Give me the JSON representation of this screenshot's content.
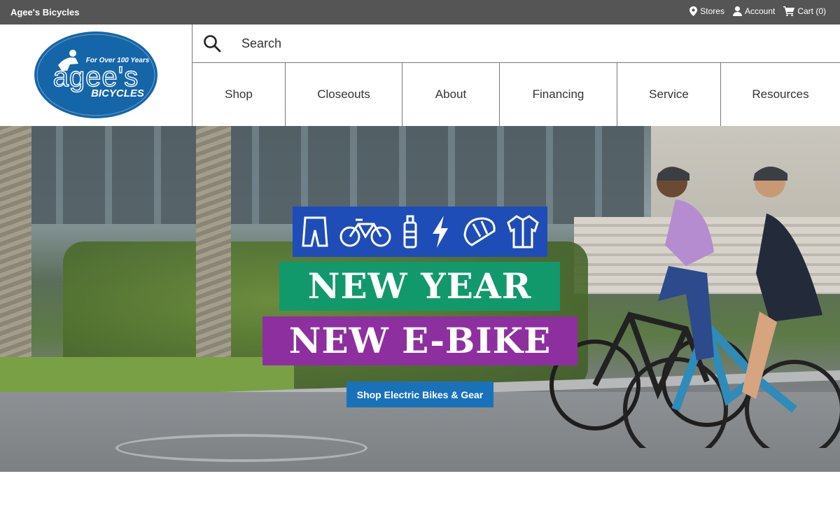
{
  "topbar": {
    "site_name": "Agee's Bicycles",
    "links": [
      {
        "label": "Stores",
        "icon": "map-pin-icon"
      },
      {
        "label": "Account",
        "icon": "user-icon"
      },
      {
        "label": "Cart (0)",
        "icon": "cart-icon"
      }
    ]
  },
  "logo": {
    "text_main": "agee's",
    "text_sub": "BICYCLES",
    "tagline": "For Over 100 Years",
    "color": "#1565a9"
  },
  "search": {
    "placeholder": "Search",
    "icon": "search-icon"
  },
  "nav": {
    "items": [
      {
        "label": "Shop"
      },
      {
        "label": "Closeouts"
      },
      {
        "label": "About"
      },
      {
        "label": "Financing"
      },
      {
        "label": "Service"
      },
      {
        "label": "Resources"
      }
    ]
  },
  "hero": {
    "promo_icons": [
      "shorts-icon",
      "bicycle-icon",
      "water-bottle-icon",
      "lightning-icon",
      "helmet-icon",
      "jersey-icon"
    ],
    "headline_1": "NEW YEAR",
    "headline_2": "NEW E-BIKE",
    "cta_label": "Shop Electric Bikes & Gear",
    "colors": {
      "icons_bg": "#1f4db7",
      "headline_1_bg": "#11996b",
      "headline_2_bg": "#8e2fa0",
      "cta_bg": "#1972b9"
    }
  }
}
